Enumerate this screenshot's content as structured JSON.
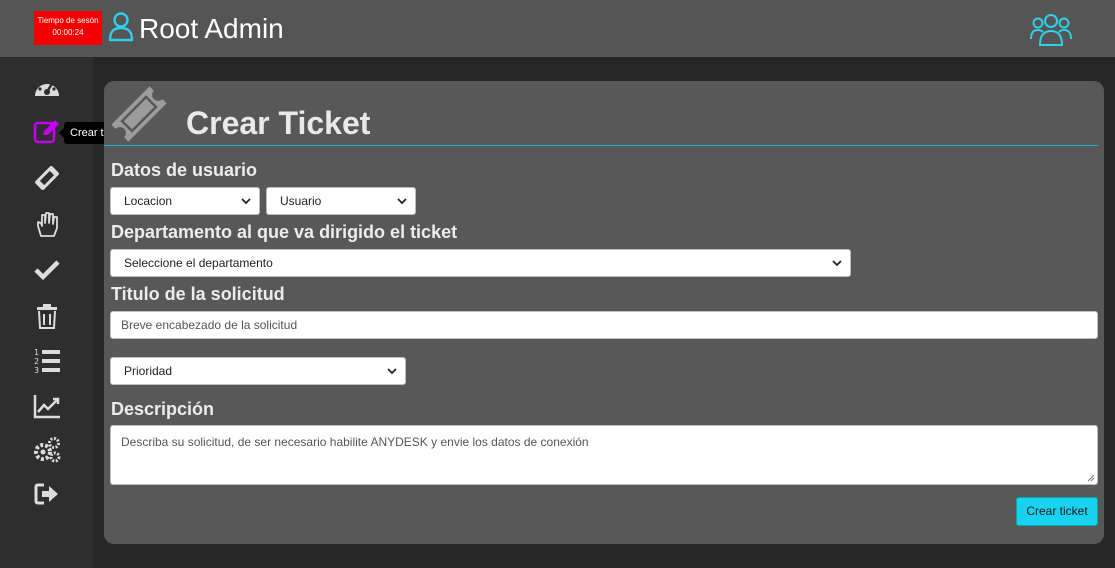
{
  "header": {
    "session_label": "Tiempo de sesón",
    "session_time": "00:00:24",
    "user_name": "Root Admin",
    "user_icon": "user-outline-icon",
    "users_icon": "users-group-icon",
    "accent_color": "#19b6c9",
    "session_color": "#f20000"
  },
  "sidebar": {
    "items": [
      {
        "icon": "dashboard-gauge-icon"
      },
      {
        "icon": "edit-square-icon",
        "active_color": "#c400f0"
      },
      {
        "icon": "ticket-icon"
      },
      {
        "icon": "hand-icon"
      },
      {
        "icon": "check-icon"
      },
      {
        "icon": "trash-icon"
      },
      {
        "icon": "ordered-list-icon"
      },
      {
        "icon": "chart-line-icon"
      },
      {
        "icon": "gears-icon"
      },
      {
        "icon": "sign-out-icon"
      }
    ],
    "tooltip": "Crear ticket"
  },
  "form": {
    "title": "Crear Ticket",
    "section_user": "Datos de usuario",
    "location_select": "Locacion",
    "user_select": "Usuario",
    "section_department": "Departamento al que va dirigido el ticket",
    "department_select": "Seleccione el departamento",
    "section_title": "Titulo de la solicitud",
    "title_placeholder": "Breve encabezado de la solicitud",
    "priority_select": "Prioridad",
    "section_description": "Descripción",
    "description_placeholder": "Describa su solicitud, de ser necesario habilite ANYDESK y envie los datos de conexión",
    "submit_label": "Crear ticket"
  }
}
